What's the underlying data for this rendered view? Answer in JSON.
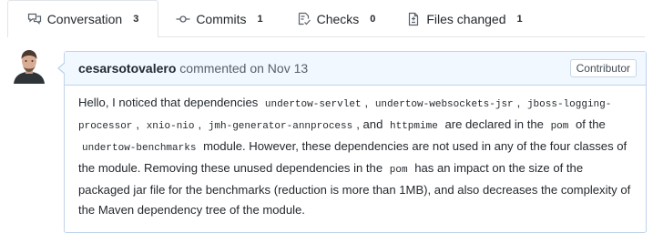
{
  "tabs": [
    {
      "label": "Conversation",
      "count": "3",
      "icon": "comment-discussion-icon",
      "selected": true
    },
    {
      "label": "Commits",
      "count": "1",
      "icon": "git-commit-icon",
      "selected": false
    },
    {
      "label": "Checks",
      "count": "0",
      "icon": "checklist-icon",
      "selected": false
    },
    {
      "label": "Files changed",
      "count": "1",
      "icon": "file-diff-icon",
      "selected": false
    }
  ],
  "comment": {
    "author": "cesarsotovalero",
    "action": "commented on",
    "date": "Nov 13",
    "role": "Contributor",
    "body": {
      "s1": "Hello, I noticed that dependencies",
      "c1": "undertow-servlet",
      "s2": ",",
      "c2": "undertow-websockets-jsr",
      "s3": ",",
      "c3": "jboss-logging-processor",
      "s4": ",",
      "c4": "xnio-nio",
      "s5": ",",
      "c5": "jmh-generator-annprocess",
      "s6": ", and",
      "c6": "httpmime",
      "s7": "are declared in the",
      "c7": "pom",
      "s8": "of the",
      "c8": "undertow-benchmarks",
      "s9": "module. However, these dependencies are not used in any of the four classes of the module. Removing these unused dependencies in the",
      "c9": "pom",
      "s10": "has an impact on the size of the packaged jar file for the benchmarks (reduction is more than 1MB), and also decreases the complexity of the Maven dependency tree of the module."
    }
  },
  "colors": {
    "header_bg": "#f1f8ff",
    "comment_border": "#c0d3eb",
    "tab_border": "#e1e4e8",
    "text": "#24292e",
    "muted": "#586069"
  }
}
